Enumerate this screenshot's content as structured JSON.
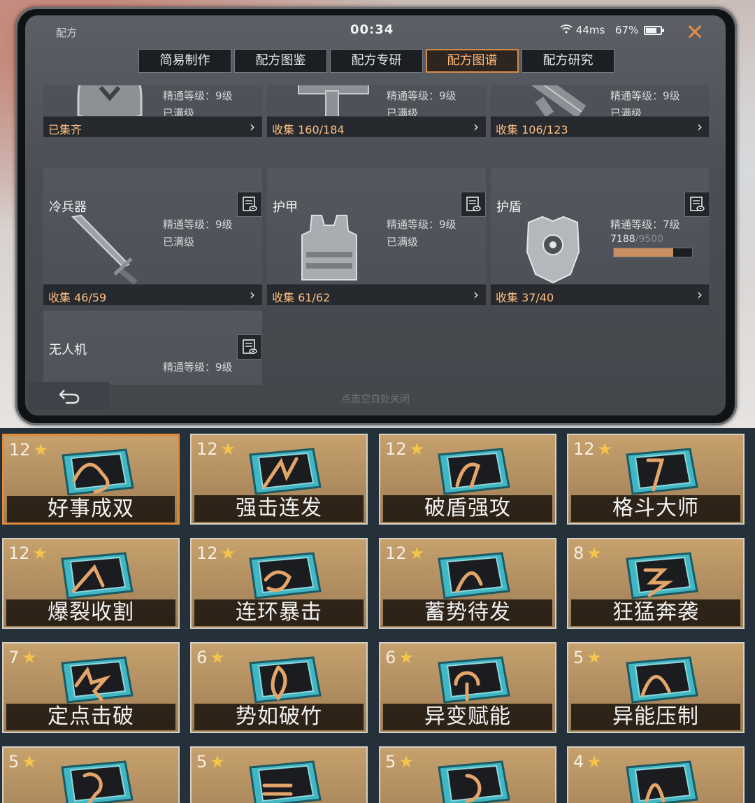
{
  "window": {
    "title": "配方",
    "time": "00:34",
    "ping": "44ms",
    "battery": "67%"
  },
  "tabs": [
    "简易制作",
    "配方图鉴",
    "配方专研",
    "配方图谱",
    "配方研究"
  ],
  "active_tab": 3,
  "top_cards": [
    {
      "mastery": "精通等级：9级",
      "status": "已满级",
      "collect": "已集齐"
    },
    {
      "mastery": "精通等级：9级",
      "status": "已满级",
      "collect": "收集 160/184"
    },
    {
      "mastery": "精通等级：9级",
      "status": "已满级",
      "collect": "收集 106/123"
    }
  ],
  "cards": [
    {
      "title": "冷兵器",
      "mastery": "精通等级：9级",
      "status": "已满级",
      "collect": "收集 46/59",
      "icon": "blade-icon"
    },
    {
      "title": "护甲",
      "mastery": "精通等级：9级",
      "status": "已满级",
      "collect": "收集 61/62",
      "icon": "vest-icon"
    },
    {
      "title": "护盾",
      "mastery": "精通等级：7级",
      "progress_current": "7188",
      "progress_max": "/9500",
      "progress_fraction": 0.757,
      "collect": "收集 37/40",
      "icon": "shield-armor-icon"
    },
    {
      "title": "无人机",
      "mastery": "精通等级：9级",
      "icon": "drone-icon"
    }
  ],
  "hint": "点击空白处关闭",
  "perks": [
    {
      "level": "12",
      "name": "好事成双",
      "selected": true
    },
    {
      "level": "12",
      "name": "强击连发"
    },
    {
      "level": "12",
      "name": "破盾强攻"
    },
    {
      "level": "12",
      "name": "格斗大师"
    },
    {
      "level": "12",
      "name": "爆裂收割"
    },
    {
      "level": "12",
      "name": "连环暴击"
    },
    {
      "level": "12",
      "name": "蓄势待发"
    },
    {
      "level": "8",
      "name": "狂猛奔袭"
    },
    {
      "level": "7",
      "name": "定点击破"
    },
    {
      "level": "6",
      "name": "势如破竹"
    },
    {
      "level": "6",
      "name": "异变赋能"
    },
    {
      "level": "5",
      "name": "异能压制"
    },
    {
      "level": "5",
      "name": ""
    },
    {
      "level": "5",
      "name": ""
    },
    {
      "level": "5",
      "name": ""
    },
    {
      "level": "4",
      "name": ""
    }
  ],
  "colors": {
    "accent": "#d48a46",
    "collect_text": "#ffbf85",
    "star": "#f4c54a",
    "chip_teal": "#3fb7c4"
  }
}
